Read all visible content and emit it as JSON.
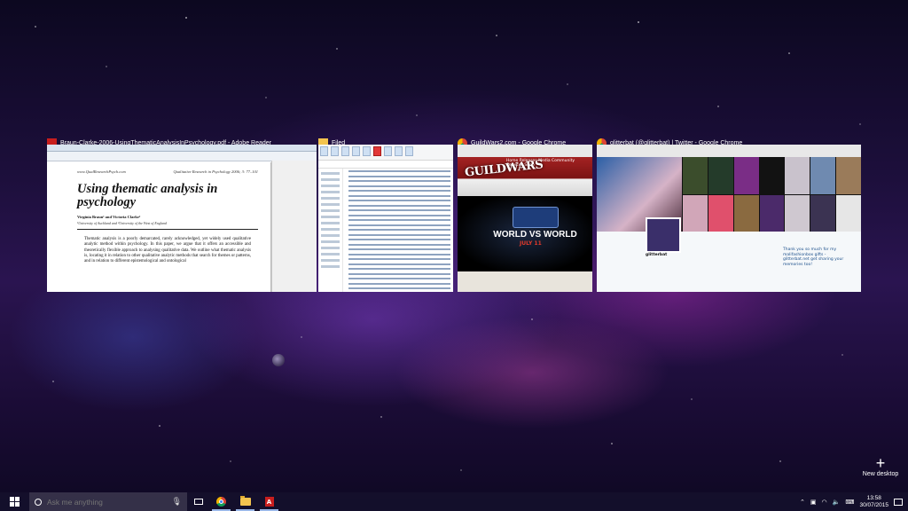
{
  "windows": [
    {
      "title": "Braun-Clarke-2006-UsingThematicAnalysisInPsychology.pdf - Adobe Reader",
      "icon": "adobe-reader-icon",
      "doc": {
        "header_left": "www.QualResearchPsych.com",
        "header_right": "Qualitative Research in Psychology 2006; 3: 77–101",
        "title": "Using thematic analysis in psychology",
        "authors": "Virginia Braun¹ and Victoria Clarke²",
        "affiliation": "¹University of Auckland and ²University of the West of England",
        "abstract": "Thematic analysis is a poorly demarcated, rarely acknowledged, yet widely used qualitative analytic method within psychology. In this paper, we argue that it offers an accessible and theoretically flexible approach to analysing qualitative data. We outline what thematic analysis is, locating it in relation to other qualitative analytic methods that search for themes or patterns, and in relation to different epistemological and ontological"
      }
    },
    {
      "title": "Filed",
      "icon": "folder-icon"
    },
    {
      "title": "GuildWars2.com - Google Chrome",
      "icon": "chrome-icon",
      "page": {
        "logo": "GUILDWARS",
        "menu": "Home   Releases   Media   Community   Services   Shop",
        "headline": "WORLD VS WORLD",
        "subline": "JULY 11"
      }
    },
    {
      "title": "glitterbat (@glitterbat) | Twitter - Google Chrome",
      "icon": "chrome-icon",
      "page": {
        "username": "glitterbat",
        "tweet": "Thank you so much for my malifashionbox gifts - glitterbat.net get sharing your memories too!"
      }
    }
  ],
  "new_desktop": {
    "label": "New desktop",
    "icon": "plus-icon"
  },
  "taskbar": {
    "search_placeholder": "Ask me anything",
    "apps": [
      "Google Chrome",
      "File Explorer",
      "Adobe Reader"
    ],
    "clock": {
      "time": "13:58",
      "date": "30/07/2015"
    }
  }
}
